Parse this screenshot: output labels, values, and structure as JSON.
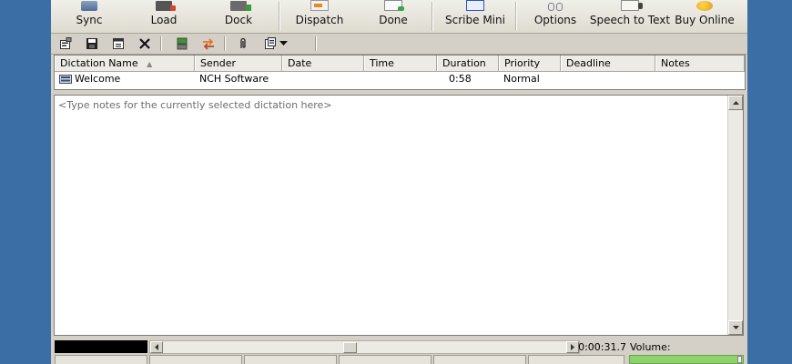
{
  "toolbar": {
    "buttons": [
      {
        "label": "Sync",
        "icon": "sync-icon"
      },
      {
        "label": "Load",
        "icon": "load-icon"
      },
      {
        "label": "Dock",
        "icon": "dock-icon"
      },
      {
        "label": "Dispatch",
        "icon": "dispatch-icon"
      },
      {
        "label": "Done",
        "icon": "done-icon"
      },
      {
        "label": "Scribe Mini",
        "icon": "scribe-mini-icon"
      },
      {
        "label": "Options",
        "icon": "options-icon"
      },
      {
        "label": "Speech to Text",
        "icon": "speech-to-text-icon"
      },
      {
        "label": "Buy Online",
        "icon": "buy-online-icon"
      }
    ]
  },
  "secondary_toolbar": {
    "icons": [
      "properties-icon",
      "save-icon",
      "window-icon",
      "delete-icon",
      "convert-icon",
      "swap-icon",
      "attachment-icon",
      "template-icon",
      "dropdown-arrow-icon"
    ]
  },
  "list": {
    "columns": [
      "Dictation Name",
      "Sender",
      "Date",
      "Time",
      "Duration",
      "Priority",
      "Deadline",
      "Notes"
    ],
    "sort_indicator": "▲",
    "rows": [
      {
        "name": "Welcome",
        "sender": "NCH Software",
        "date": "",
        "time": "",
        "duration": "0:58",
        "priority": "Normal",
        "deadline": "",
        "notes": ""
      }
    ]
  },
  "notes": {
    "placeholder": "<Type notes for the currently selected dictation here>"
  },
  "status": {
    "time": "0:00:31.7",
    "volume_label": "Volume:"
  },
  "colors": {
    "desktop": "#3a6ea5",
    "window": "#d4d0c8",
    "volume_fill": "#8fd16a"
  }
}
